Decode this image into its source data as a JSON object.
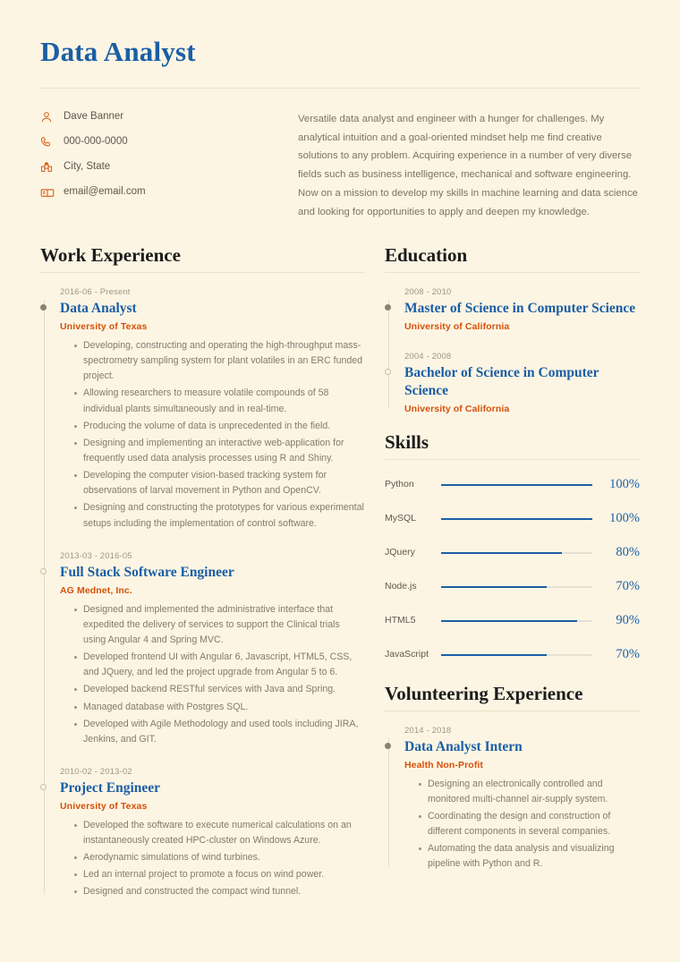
{
  "header": {
    "title": "Data Analyst"
  },
  "contact": {
    "items": [
      {
        "icon": "person-icon",
        "text": "Dave Banner"
      },
      {
        "icon": "phone-icon",
        "text": "000-000-0000"
      },
      {
        "icon": "location-icon",
        "text": "City, State"
      },
      {
        "icon": "mailbox-icon",
        "text": "email@email.com"
      }
    ]
  },
  "summary": {
    "text": "Versatile data analyst and engineer with a hunger for challenges. My analytical intuition and a goal-oriented mindset help me find creative solutions to any problem. Acquiring experience in a number of very diverse fields such as business intelligence, mechanical and software engineering. Now on a mission to develop my skills in machine learning and data science and looking for opportunities to apply and deepen my knowledge."
  },
  "work": {
    "section_title": "Work Experience",
    "entries": [
      {
        "date": "2016-06 - Present",
        "title": "Data Analyst",
        "org": "University of Texas",
        "points": [
          "Developing, constructing and operating the high-throughput mass-spectrometry sampling system for plant volatiles in an ERC funded project.",
          "Allowing researchers to measure volatile compounds of 58 individual plants simultaneously and in real-time.",
          "Producing the volume of data is unprecedented in the field.",
          "Designing and implementing an interactive web-application for frequently used data analysis processes using R and Shiny.",
          "Developing the computer vision-based tracking system for observations of larval movement in Python and OpenCV.",
          "Designing and constructing the prototypes for various experimental setups including the implementation of control software."
        ]
      },
      {
        "date": "2013-03 - 2016-05",
        "title": "Full Stack Software Engineer",
        "org": "AG Mednet, Inc.",
        "points": [
          "Designed and implemented the administrative interface that expedited the delivery of services to support the Clinical trials using Angular 4 and Spring MVC.",
          "Developed frontend UI with Angular 6, Javascript, HTML5, CSS, and JQuery, and led the project upgrade from Angular 5 to 6.",
          "Developed backend RESTful services with Java and Spring.",
          "Managed database with Postgres SQL.",
          "Developed with Agile Methodology and used tools including JIRA, Jenkins, and GIT."
        ]
      },
      {
        "date": "2010-02 - 2013-02",
        "title": "Project Engineer",
        "org": "University of Texas",
        "points": [
          "Developed the software to execute numerical calculations on an instantaneously created HPC-cluster on Windows Azure.",
          "Aerodynamic simulations of wind turbines.",
          "Led an internal project to promote a focus on wind power.",
          "Designed and constructed the compact wind tunnel."
        ]
      }
    ]
  },
  "education": {
    "section_title": "Education",
    "entries": [
      {
        "date": "2008 - 2010",
        "title": "Master of Science in Computer Science",
        "org": "University of California",
        "points": []
      },
      {
        "date": "2004 - 2008",
        "title": "Bachelor of Science in Computer Science",
        "org": "University of California",
        "points": []
      }
    ]
  },
  "skills": {
    "section_title": "Skills",
    "items": [
      {
        "name": "Python",
        "percent": 100,
        "label": "100%"
      },
      {
        "name": "MySQL",
        "percent": 100,
        "label": "100%"
      },
      {
        "name": "JQuery",
        "percent": 80,
        "label": "80%"
      },
      {
        "name": "Node.js",
        "percent": 70,
        "label": "70%"
      },
      {
        "name": "HTML5",
        "percent": 90,
        "label": "90%"
      },
      {
        "name": "JavaScript",
        "percent": 70,
        "label": "70%"
      }
    ]
  },
  "volunteering": {
    "section_title": "Volunteering Experience",
    "entries": [
      {
        "date": "2014 - 2018",
        "title": "Data Analyst Intern",
        "org": "Health Non-Profit",
        "points": [
          "Designing an electronically controlled and monitored multi-channel air-supply system.",
          "Coordinating the design and construction of different components in several companies.",
          "Automating the data analysis and visualizing pipeline with Python and R."
        ]
      }
    ]
  },
  "colors": {
    "background": "#fdf5e3",
    "accent_blue": "#1b5ea6",
    "accent_orange": "#d4510a",
    "body_text": "#857a6c",
    "rule": "#ece1c9"
  }
}
